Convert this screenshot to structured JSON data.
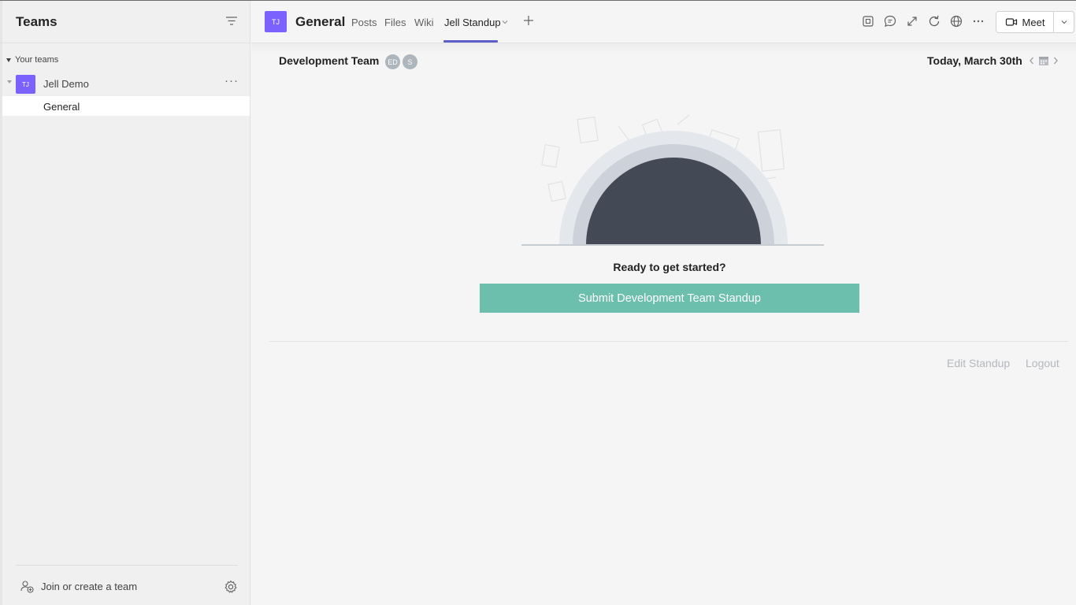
{
  "sidebar": {
    "title": "Teams",
    "section_label": "Your teams",
    "team": {
      "avatar": "TJ",
      "name": "Jell Demo"
    },
    "channel": {
      "name": "General"
    },
    "join_label": "Join or create a team"
  },
  "header": {
    "avatar": "TJ",
    "channel_title": "General",
    "tabs": [
      {
        "label": "Posts"
      },
      {
        "label": "Files"
      },
      {
        "label": "Wiki"
      },
      {
        "label": "Jell Standup"
      }
    ],
    "meet_label": "Meet"
  },
  "standup": {
    "team_name": "Development Team",
    "members": [
      "ED",
      "S"
    ],
    "date": "Today, March 30th",
    "prompt": "Ready to get started?",
    "submit_label": "Submit Development Team Standup",
    "edit_label": "Edit Standup",
    "logout_label": "Logout"
  },
  "colors": {
    "brand_purple": "#7b61ff",
    "tab_accent": "#5b5fc7",
    "submit_green": "#6cbfad",
    "dome_dark": "#434955"
  },
  "icons": [
    "filter-icon",
    "add-team-icon",
    "gear-icon",
    "add-tab-icon",
    "popout-icon",
    "chat-icon",
    "expand-icon",
    "refresh-icon",
    "globe-icon",
    "more-options-icon",
    "video-camera-icon",
    "chevron-down-icon",
    "chevron-left-icon",
    "calendar-icon",
    "chevron-right-icon"
  ]
}
